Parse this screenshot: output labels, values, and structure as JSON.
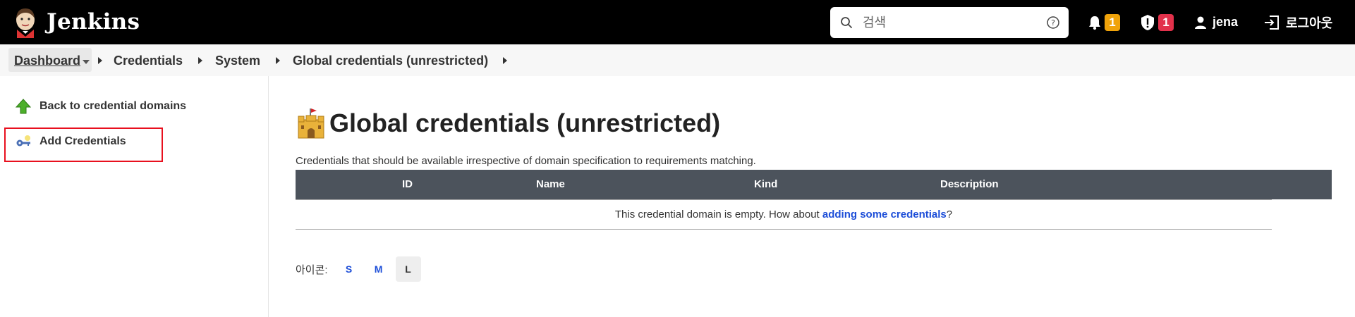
{
  "header": {
    "brand": "Jenkins",
    "search": {
      "placeholder": "검색"
    },
    "notifications_count": "1",
    "security_count": "1",
    "user": "jena",
    "logout_label": "로그아웃"
  },
  "breadcrumb": {
    "items": [
      "Dashboard",
      "Credentials",
      "System",
      "Global credentials (unrestricted)"
    ]
  },
  "sidebar": {
    "items": [
      {
        "label": "Back to credential domains",
        "icon": "arrow-up-icon"
      },
      {
        "label": "Add Credentials",
        "icon": "key-icon"
      }
    ]
  },
  "main": {
    "title": "Global credentials (unrestricted)",
    "description": "Credentials that should be available irrespective of domain specification to requirements matching.",
    "table": {
      "columns": [
        "ID",
        "Name",
        "Kind",
        "Description"
      ],
      "empty_prefix": "This credential domain is empty. How about ",
      "empty_link": "adding some credentials",
      "empty_suffix": "?"
    },
    "icon_size": {
      "label": "아이콘:",
      "options": [
        "S",
        "M",
        "L"
      ],
      "selected": "L"
    }
  },
  "colors": {
    "header_bg": "#000000",
    "table_header_bg": "#4c535c",
    "link": "#1d4ed8",
    "badge_orange": "#f0a30a",
    "badge_red": "#e2314b",
    "highlight": "#e8101e"
  }
}
